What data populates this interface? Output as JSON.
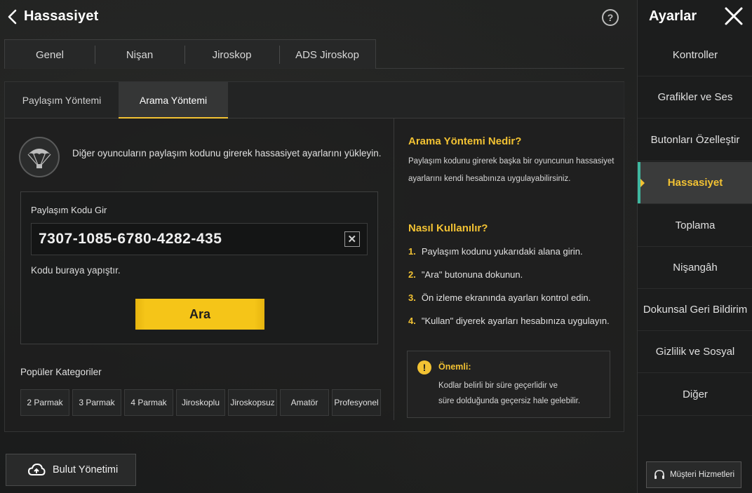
{
  "header": {
    "title": "Hassasiyet",
    "help": "?"
  },
  "main_tabs": [
    "Genel",
    "Nişan",
    "Jiroskop",
    "ADS Jiroskop"
  ],
  "sub_tabs": [
    "Paylaşım Yöntemi",
    "Arama Yöntemi"
  ],
  "intro": "Diğer oyuncuların paylaşım kodunu girerek hassasiyet ayarlarını yükleyin.",
  "code": {
    "label": "Paylaşım Kodu Gir",
    "value": "7307-1085-6780-4282-435",
    "clear": "✕",
    "hint": "Kodu buraya yapıştır.",
    "search_button": "Ara"
  },
  "categories": {
    "title": "Popüler Kategoriler",
    "items": [
      "2 Parmak",
      "3 Parmak",
      "4 Parmak",
      "Jiroskoplu",
      "Jiroskopsuz",
      "Amatör",
      "Profesyonel"
    ]
  },
  "info": {
    "what_title": "Arama Yöntemi Nedir?",
    "what_line1": "Paylaşım kodunu girerek başka bir oyuncunun hassasiyet",
    "what_line2": "ayarlarını kendi hesabınıza uygulayabilirsiniz.",
    "how_title": "Nasıl Kullanılır?",
    "steps": [
      {
        "n": "1.",
        "text": "Paylaşım kodunu yukarıdaki alana girin."
      },
      {
        "n": "2.",
        "text": "\"Ara\" butonuna dokunun."
      },
      {
        "n": "3.",
        "text": "Ön izleme ekranında ayarları kontrol edin."
      },
      {
        "n": "4.",
        "text": "\"Kullan\" diyerek ayarları hesabınıza uygulayın."
      }
    ],
    "important_icon": "!",
    "important_title": "Önemli:",
    "important_line1": "Kodlar belirli bir süre geçerlidir ve",
    "important_line2": "süre dolduğunda geçersiz hale gelebilir."
  },
  "cloud_button": "Bulut Yönetimi",
  "sidebar": {
    "title": "Ayarlar",
    "items": [
      "Kontroller",
      "Grafikler ve Ses",
      "Butonları Özelleştir",
      "Hassasiyet",
      "Toplama",
      "Nişangâh",
      "Dokunsal Geri Bildirim",
      "Gizlilik ve Sosyal",
      "Diğer"
    ],
    "active": "Hassasiyet",
    "support": "Müşteri Hizmetleri"
  },
  "colors": {
    "accent": "#f2c233",
    "button": "#f5c518",
    "active_marker": "#3fb8a0"
  },
  "icons": [
    "back-arrow-icon",
    "help-icon",
    "close-icon",
    "parachute-icon",
    "clear-icon",
    "warning-icon",
    "cloud-icon",
    "headset-icon"
  ]
}
